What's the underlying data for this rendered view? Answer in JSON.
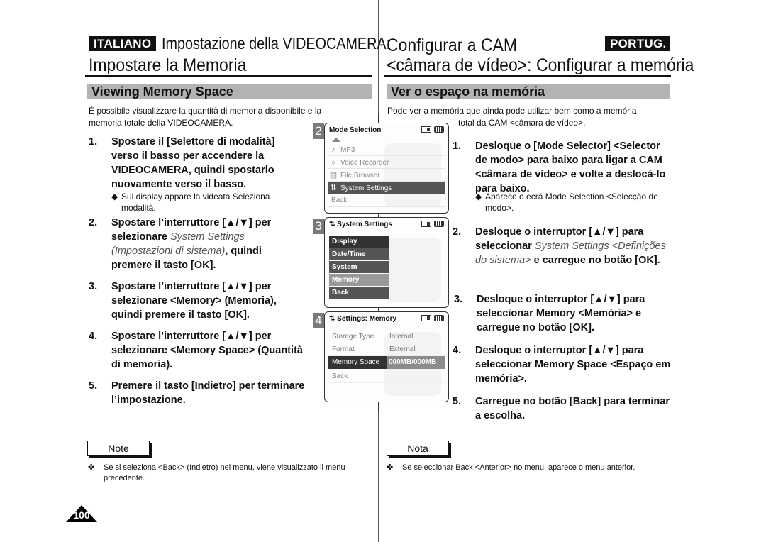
{
  "left": {
    "lang_badge": "ITALIANO",
    "header_line1": "Impostazione della VIDEOCAMERA:",
    "header_line2": "Impostare la Memoria",
    "section_title": "Viewing Memory Space",
    "intro": "È possibile visualizzare la quantità di memoria disponibile e la memoria totale della VIDEOCAMERA.",
    "steps": [
      {
        "num": "1.",
        "text": "Spostare il [Selettore di modalità] verso il basso per accendere la VIDEOCAMERA, quindi spostarlo nuovamente verso il basso.",
        "sub": "Sul display appare la videata Seleziona modalità."
      },
      {
        "num": "2.",
        "pre": "Spostare l’interruttore [▲/▼] per selezionare ",
        "ital": "System Settings (Impostazioni di sistema)",
        "post": ", quindi premere il tasto [OK]."
      },
      {
        "num": "3.",
        "text": "Spostare l’interruttore [▲/▼] per selezionare <Memory> (Memoria), quindi premere il tasto [OK]."
      },
      {
        "num": "4.",
        "text": "Spostare l’interruttore [▲/▼] per selezionare <Memory Space> (Quantità di memoria)."
      },
      {
        "num": "5.",
        "text": "Premere il tasto [Indietro] per terminare l’impostazione."
      }
    ],
    "note_label": "Note",
    "note_text": "Se si seleziona <Back> (Indietro) nel menu, viene visualizzato il menu precedente."
  },
  "right": {
    "lang_badge": "PORTUG.",
    "header_line1": "Configurar a CAM",
    "header_line2": "<câmara de vídeo>: Configurar a memória",
    "section_title": "Ver o espaço na memória",
    "intro_line1": "Pode ver a memória que ainda pode utilizar bem como a memória",
    "intro_line2": "total da CAM <câmara de vídeo>.",
    "steps": [
      {
        "num": "1.",
        "text": "Desloque o [Mode Selector] <Selector de modo> para baixo para ligar a CAM <câmara de vídeo> e volte a deslocá-lo para baixo.",
        "sub": "Aparece o ecrã Mode Selection <Selecção de modo>."
      },
      {
        "num": "2.",
        "pre": "Desloque o interruptor [▲/▼] para seleccionar ",
        "ital": "System Settings <Definições do sistema>",
        "post": " e carregue no botão [OK]."
      },
      {
        "num": "3.",
        "text": "Desloque o interruptor [▲/▼] para seleccionar Memory <Memória> e carregue no botão [OK]."
      },
      {
        "num": "4.",
        "text": "Desloque o interruptor [▲/▼] para seleccionar Memory Space <Espaço em memória>."
      },
      {
        "num": "5.",
        "text": "Carregue no botão [Back] para terminar a escolha."
      }
    ],
    "note_label": "Nota",
    "note_text": "Se seleccionar Back <Anterior> no menu, aparece o menu anterior."
  },
  "screens": {
    "s2": {
      "num": "2",
      "title": "Mode Selection",
      "items": [
        {
          "icon": "music-note-icon",
          "glyph": "♪",
          "label": "MP3"
        },
        {
          "icon": "microphone-icon",
          "glyph": "🎙",
          "label": "Voice Recorder"
        },
        {
          "icon": "file-icon",
          "glyph": "▤",
          "label": "File Browser"
        },
        {
          "icon": "settings-icon",
          "glyph": "⇅",
          "label": "System Settings",
          "selected": true
        },
        {
          "label": "Back"
        }
      ]
    },
    "s3": {
      "num": "3",
      "title": "System Settings",
      "items": [
        "Display",
        "Date/Time",
        "System",
        "Memory",
        "Back"
      ],
      "selected": "Memory"
    },
    "s4": {
      "num": "4",
      "title": "Settings: Memory",
      "rows": [
        {
          "key": "Storage Type",
          "value": "Internal"
        },
        {
          "key": "Format",
          "value": "External"
        },
        {
          "key": "Memory Space",
          "value": "000MB/000MB",
          "selected": true
        },
        {
          "key": "Back",
          "value": ""
        }
      ]
    }
  },
  "bullets": {
    "diamond": "◆",
    "note": "✤"
  },
  "page_number": "100"
}
